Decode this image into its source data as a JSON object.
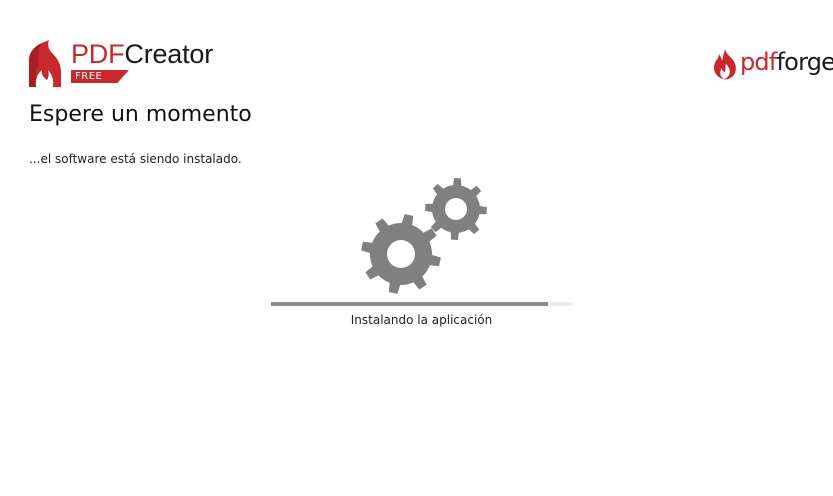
{
  "header": {
    "logo_brand_pdf": "PDF",
    "logo_brand_creator": "Creator",
    "logo_badge": "FREE",
    "partner_pdf": "pdf",
    "partner_forge": "forge"
  },
  "main": {
    "title": "Espere un momento",
    "subtitle": "...el software está siendo instalado.",
    "progress": {
      "value_fraction": 0.92,
      "status_text": "Instalando la aplicación"
    }
  },
  "icons": {
    "logo": "pdfcreator-flame-icon",
    "partner_logo": "pdfforge-flame-icon",
    "activity": "gears-icon"
  },
  "colors": {
    "brand_red": "#c9282d",
    "gear_gray": "#808080",
    "progress_fill": "#8c8c8c",
    "progress_track": "#ececec"
  }
}
